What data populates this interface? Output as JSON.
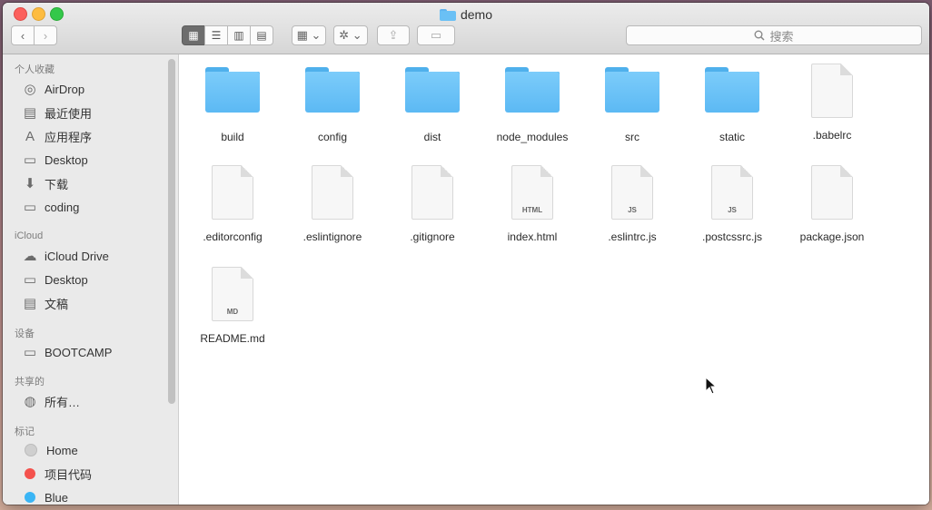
{
  "window": {
    "title": "demo"
  },
  "toolbar": {
    "back": "‹",
    "forward": "›",
    "views": [
      "▦",
      "☰",
      "▥",
      "▤"
    ],
    "arrange": "▦ ⌄",
    "action": "✲ ⌄",
    "share": "⇪",
    "tag": "▭",
    "search_placeholder": "搜索"
  },
  "sidebar": {
    "sections": {
      "favorites": "个人收藏",
      "icloud": "iCloud",
      "devices": "设备",
      "shared": "共享的",
      "tags": "标记"
    },
    "favorites": [
      {
        "label": "AirDrop",
        "icon": "airdrop-icon",
        "glyph": "◎"
      },
      {
        "label": "最近使用",
        "icon": "recents-icon",
        "glyph": "▤"
      },
      {
        "label": "应用程序",
        "icon": "applications-icon",
        "glyph": "A"
      },
      {
        "label": "Desktop",
        "icon": "desktop-icon",
        "glyph": "▭"
      },
      {
        "label": "下载",
        "icon": "downloads-icon",
        "glyph": "⬇"
      },
      {
        "label": "coding",
        "icon": "folder-icon",
        "glyph": "▭"
      }
    ],
    "icloud": [
      {
        "label": "iCloud Drive",
        "icon": "cloud-icon",
        "glyph": "☁"
      },
      {
        "label": "Desktop",
        "icon": "desktop-icon",
        "glyph": "▭"
      },
      {
        "label": "文稿",
        "icon": "documents-icon",
        "glyph": "▤"
      }
    ],
    "devices": [
      {
        "label": "BOOTCAMP",
        "icon": "disk-icon",
        "glyph": "▭"
      }
    ],
    "shared": [
      {
        "label": "所有…",
        "icon": "network-icon",
        "glyph": "◍"
      }
    ],
    "tags": [
      {
        "label": "Home",
        "color": "#cfcfcf"
      },
      {
        "label": "项目代码",
        "color": "#f4524d"
      },
      {
        "label": "Blue",
        "color": "#3ab5f5"
      }
    ]
  },
  "files": [
    {
      "name": "build",
      "kind": "folder"
    },
    {
      "name": "config",
      "kind": "folder"
    },
    {
      "name": "dist",
      "kind": "folder"
    },
    {
      "name": "node_modules",
      "kind": "folder"
    },
    {
      "name": "src",
      "kind": "folder"
    },
    {
      "name": "static",
      "kind": "folder"
    },
    {
      "name": ".babelrc",
      "kind": "doc",
      "badge": ""
    },
    {
      "name": ".editorconfig",
      "kind": "doc",
      "badge": ""
    },
    {
      "name": ".eslintignore",
      "kind": "doc",
      "badge": ""
    },
    {
      "name": ".gitignore",
      "kind": "doc",
      "badge": ""
    },
    {
      "name": "index.html",
      "kind": "doc",
      "badge": "HTML"
    },
    {
      "name": ".eslintrc.js",
      "kind": "doc",
      "badge": "JS"
    },
    {
      "name": ".postcssrc.js",
      "kind": "doc",
      "badge": "JS"
    },
    {
      "name": "package.json",
      "kind": "doc",
      "badge": ""
    },
    {
      "name": "README.md",
      "kind": "doc",
      "badge": "MD"
    }
  ]
}
